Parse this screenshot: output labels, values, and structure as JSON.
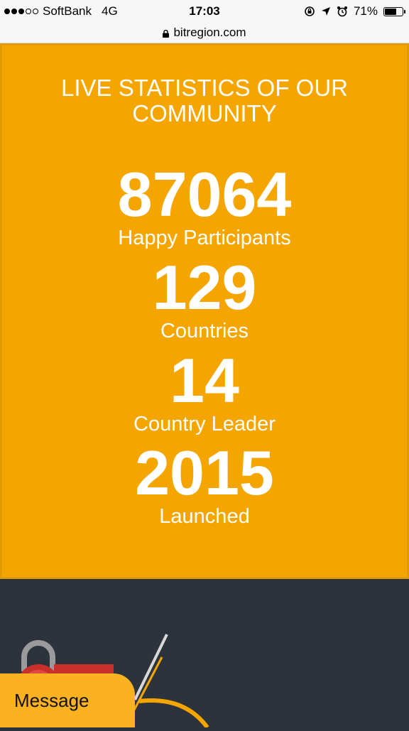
{
  "status_bar": {
    "carrier": "SoftBank",
    "network": "4G",
    "time": "17:03",
    "battery_percent": "71%",
    "battery_level": 0.71,
    "signal_bars": 3,
    "signal_total": 5
  },
  "url_bar": {
    "domain": "bitregion.com"
  },
  "stats": {
    "title": "LIVE STATISTICS OF OUR COMMUNITY",
    "items": [
      {
        "value": "87064",
        "label": "Happy Participants"
      },
      {
        "value": "129",
        "label": "Countries"
      },
      {
        "value": "14",
        "label": "Country Leader"
      },
      {
        "value": "2015",
        "label": "Launched"
      }
    ]
  },
  "message_button": {
    "label": "Message"
  },
  "colors": {
    "accent": "#f5a500",
    "dark_bg": "#2d333d",
    "message_bg": "#fbb220"
  }
}
